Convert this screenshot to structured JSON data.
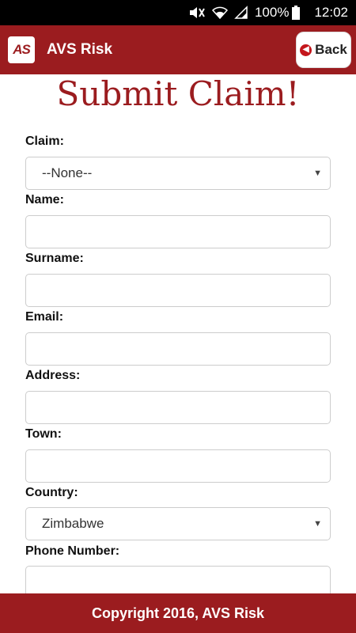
{
  "status_bar": {
    "battery_percent": "100%",
    "time": "12:02"
  },
  "app_bar": {
    "logo_text": "AS",
    "title": "AVS Risk",
    "back_label": "Back"
  },
  "page_title": "Submit Claim!",
  "form": {
    "claim_label": "Claim:",
    "claim_value": "--None--",
    "name_label": "Name:",
    "surname_label": "Surname:",
    "email_label": "Email:",
    "address_label": "Address:",
    "town_label": "Town:",
    "country_label": "Country:",
    "country_value": "Zimbabwe",
    "phone_label": "Phone Number:"
  },
  "footer": {
    "copyright": "Copyright 2016, AVS Risk"
  },
  "colors": {
    "brand": "#9b1c1f",
    "status_bar": "#000000"
  }
}
